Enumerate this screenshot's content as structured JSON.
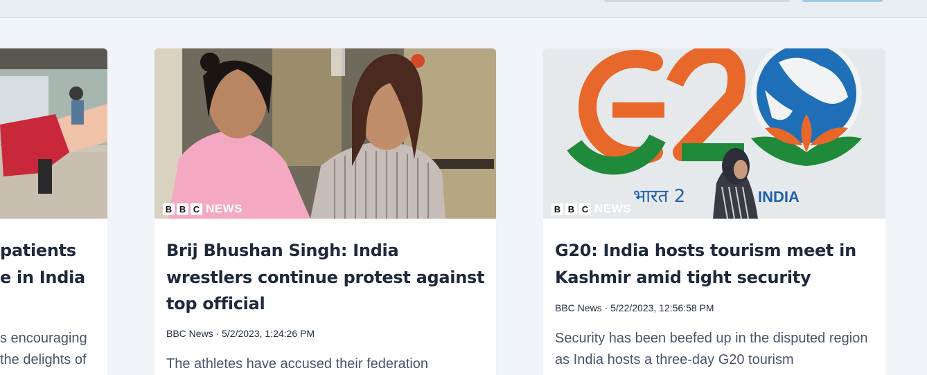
{
  "articles": [
    {
      "title": "patients e in India",
      "title_line1": "patients",
      "title_line2": "e in India",
      "desc_line1": "s encouraging",
      "desc_line2": "the delights of",
      "image": "patient-image"
    },
    {
      "title": "Brij Bhushan Singh: India wrestlers continue protest against top official",
      "meta": "BBC News · 5/2/2023, 1:24:26 PM",
      "description": "The athletes have accused their federation",
      "watermark": {
        "b1": "B",
        "b2": "B",
        "b3": "C",
        "news": "NEWS"
      },
      "image": "wrestlers-protest-image"
    },
    {
      "title": "G20: India hosts tourism meet in Kashmir amid tight security",
      "meta": "BBC News · 5/22/2023, 12:56:58 PM",
      "description": "Security has been beefed up in the disputed region as India hosts a three-day G20 tourism",
      "watermark": {
        "b1": "B",
        "b2": "B",
        "b3": "C",
        "news": "NEWS"
      },
      "mural_text": "G20",
      "mural_hindi": "भारत 2",
      "mural_india": "INDIA",
      "image": "g20-mural-image"
    }
  ],
  "colors": {
    "page_bg": "#f1f5f9",
    "title": "#1e293b",
    "desc": "#475569",
    "g20_orange": "#e8672a",
    "g20_green": "#1f8a3a",
    "g20_blue": "#1f6fb8"
  }
}
